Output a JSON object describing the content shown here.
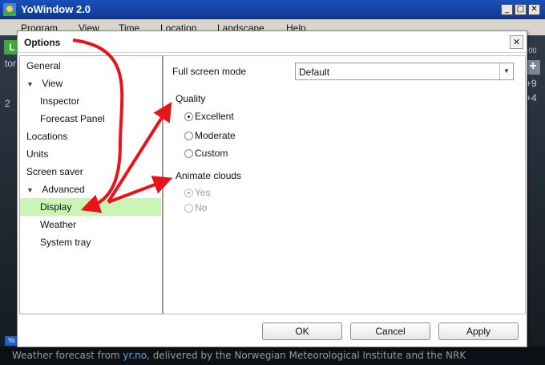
{
  "app": {
    "title": "YoWindow 2.0",
    "window_controls": [
      "_",
      "□",
      "✕"
    ],
    "menu": [
      "Program",
      "View",
      "Time",
      "Location",
      "Landscape",
      "Help"
    ],
    "side_left": {
      "badge": "L",
      "texts": [
        "tor",
        "2"
      ]
    },
    "side_right": {
      "texts": [
        ":00",
        "+9",
        "+4"
      ]
    },
    "status": {
      "prefix": "Weather forecast from ",
      "link": "yr.no",
      "suffix": ", delivered by the Norwegian Meteorological Institute and the NRK"
    },
    "yo_tag": "Yo"
  },
  "dialog": {
    "title": "Options",
    "close": "✕",
    "tree": [
      {
        "label": "General"
      },
      {
        "label": "View",
        "expander": "▼"
      },
      {
        "label": "Inspector"
      },
      {
        "label": "Forecast Panel"
      },
      {
        "label": "Locations"
      },
      {
        "label": "Units"
      },
      {
        "label": "Screen saver"
      },
      {
        "label": "Advanced",
        "expander": "▼"
      },
      {
        "label": "Display"
      },
      {
        "label": "Weather"
      },
      {
        "label": "System tray"
      }
    ],
    "content": {
      "full_screen_label": "Full screen mode",
      "full_screen_value": "Default",
      "quality_label": "Quality",
      "quality_options": [
        "Excellent",
        "Moderate",
        "Custom"
      ],
      "animate_label": "Animate clouds",
      "animate_options": [
        "Yes",
        "No"
      ]
    },
    "buttons": {
      "ok": "OK",
      "cancel": "Cancel",
      "apply": "Apply"
    }
  },
  "colors": {
    "selection": "#c9f5b5",
    "titlebar": "#1a4fb8",
    "annotation_arrow": "#e8141b"
  }
}
